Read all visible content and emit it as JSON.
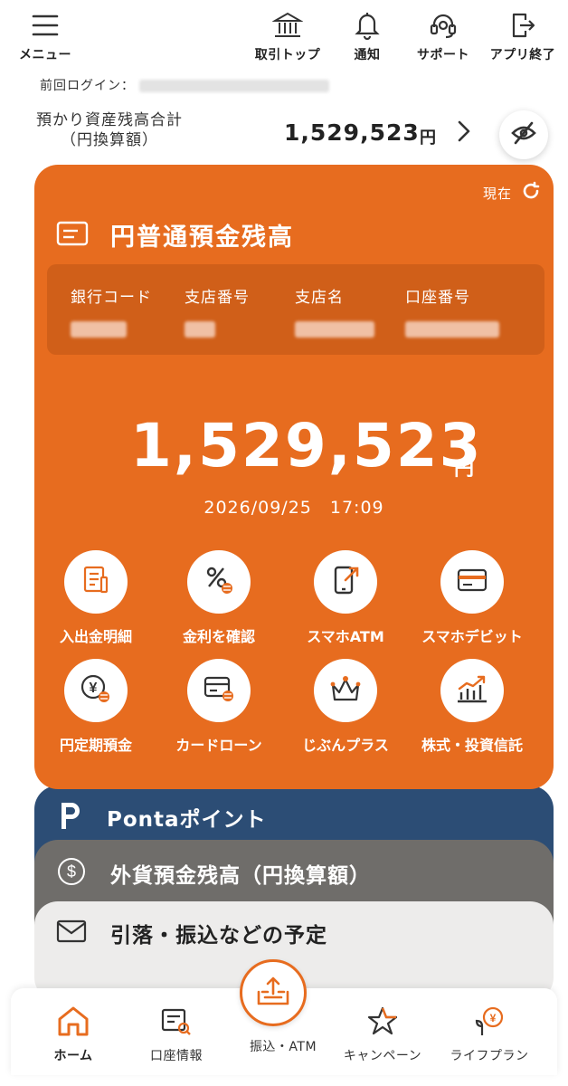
{
  "topnav": {
    "menu": {
      "label": "メニュー",
      "icon": "hamburger-icon"
    },
    "items": [
      {
        "label": "取引トップ",
        "icon": "bank-icon"
      },
      {
        "label": "通知",
        "icon": "bell-icon"
      },
      {
        "label": "サポート",
        "icon": "headset-icon"
      },
      {
        "label": "アプリ終了",
        "icon": "exit-icon"
      }
    ]
  },
  "last_login": {
    "label": "前回ログイン："
  },
  "total": {
    "label_line1": "預かり資産残高合計",
    "label_line2": "（円換算額）",
    "amount": "1,529,523",
    "currency": "円"
  },
  "account": {
    "refresh_label": "現在",
    "title": "円普通預金残高",
    "info_labels": [
      "銀行コード",
      "支店番号",
      "支店名",
      "口座番号"
    ],
    "balance": "1,529,523",
    "currency": "円",
    "timestamp": "2026/09/25　17:09"
  },
  "quick_actions": [
    {
      "label": "入出金明細",
      "icon": "statement-icon"
    },
    {
      "label": "金利を確認",
      "icon": "percent-icon"
    },
    {
      "label": "スマホATM",
      "icon": "smartphone-atm-icon"
    },
    {
      "label": "スマホデビット",
      "icon": "card-icon"
    },
    {
      "label": "円定期預金",
      "icon": "yen-coin-icon"
    },
    {
      "label": "カードローン",
      "icon": "card-loan-icon"
    },
    {
      "label": "じぶんプラス",
      "icon": "crown-icon"
    },
    {
      "label": "株式・投資信託",
      "icon": "chart-icon"
    }
  ],
  "stack_cards": {
    "ponta": "Pontaポイント",
    "fx": "外貨預金残高（円換算額）",
    "schedule": "引落・振込などの予定"
  },
  "tabbar": [
    {
      "label": "ホーム",
      "icon": "home-icon"
    },
    {
      "label": "口座情報",
      "icon": "account-info-icon"
    },
    {
      "label": "振込・ATM",
      "icon": "transfer-atm-icon"
    },
    {
      "label": "キャンペーン",
      "icon": "star-icon"
    },
    {
      "label": "ライフプラン",
      "icon": "life-plan-icon"
    }
  ],
  "colors": {
    "accent": "#e76c1f",
    "ponta": "#2c4d75",
    "fx": "#6f6d6a"
  }
}
